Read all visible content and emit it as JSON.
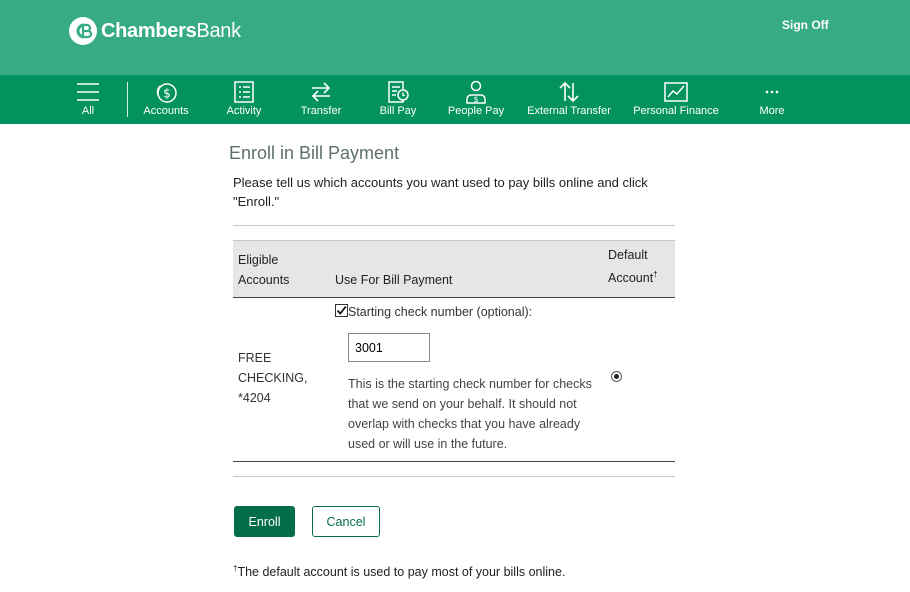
{
  "header": {
    "brand_bold": "Chambers",
    "brand_regular": "Bank",
    "sign_off": "Sign Off"
  },
  "nav": {
    "items": [
      {
        "label": "All",
        "icon": "menu-icon"
      },
      {
        "label": "Accounts",
        "icon": "dollar-coin-icon"
      },
      {
        "label": "Activity",
        "icon": "list-icon"
      },
      {
        "label": "Transfer",
        "icon": "transfer-arrows-icon"
      },
      {
        "label": "Bill Pay",
        "icon": "bill-pay-icon"
      },
      {
        "label": "People Pay",
        "icon": "person-dollar-icon"
      },
      {
        "label": "External Transfer",
        "icon": "up-down-arrows-icon"
      },
      {
        "label": "Personal Finance",
        "icon": "line-chart-icon"
      },
      {
        "label": "More",
        "icon": "ellipsis-icon"
      }
    ]
  },
  "page": {
    "title": "Enroll in Bill Payment",
    "intro": "Please tell us which accounts you want used to pay bills online and click \"Enroll.\""
  },
  "table": {
    "col_accounts_line1": "Eligible",
    "col_accounts_line2": "Accounts",
    "col_use": "Use For Bill Payment",
    "col_default_line1": "Default",
    "col_default_line2": "Account",
    "dagger": "†",
    "row": {
      "account_line1": "FREE",
      "account_line2": "CHECKING,",
      "account_line3": "*4204",
      "use_checked": true,
      "check_label": "Starting check number (optional):",
      "check_value": "3001",
      "help": "This is the starting check number for checks that we send on your behalf. It should not overlap with checks that you have already used or will use in the future.",
      "default_selected": true
    }
  },
  "actions": {
    "enroll": "Enroll",
    "cancel": "Cancel"
  },
  "footnote": {
    "dagger": "†",
    "text": "The default account is used to pay most of your bills online."
  },
  "colors": {
    "header_bg": "#37ac84",
    "nav_bg": "#04935e",
    "primary_button": "#046e4c"
  }
}
